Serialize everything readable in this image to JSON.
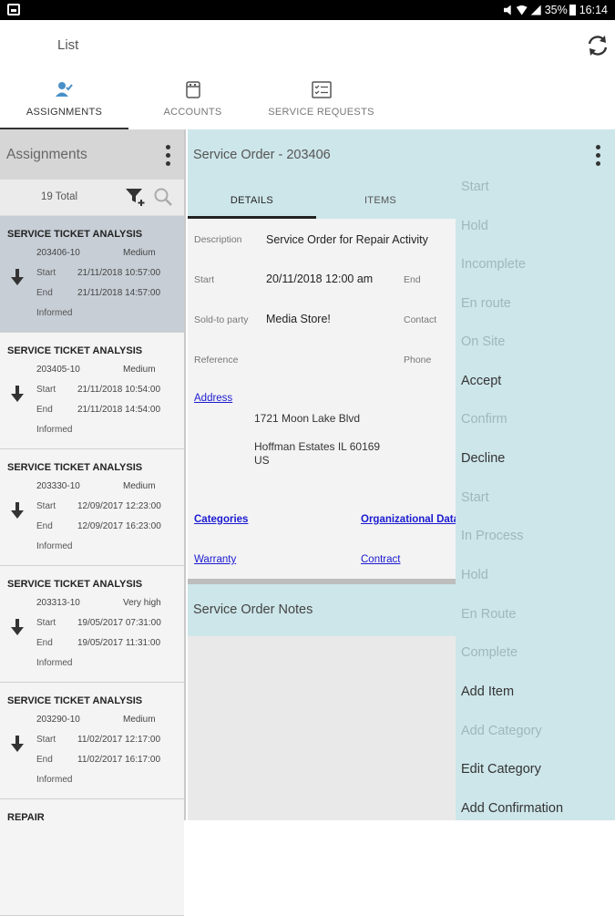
{
  "status_bar": {
    "battery": "35%",
    "time": "16:14"
  },
  "app_bar": {
    "title": "List",
    "refresh_icon": "refresh-icon"
  },
  "main_tabs": [
    {
      "label": "ASSIGNMENTS",
      "icon": "person-check-icon",
      "active": true
    },
    {
      "label": "ACCOUNTS",
      "icon": "account-book-icon",
      "active": false
    },
    {
      "label": "SERVICE REQUESTS",
      "icon": "checklist-icon",
      "active": false
    }
  ],
  "assignments": {
    "header": "Assignments",
    "total": "19 Total",
    "cards": [
      {
        "title": "SERVICE TICKET ANALYSIS",
        "id": "203406-10",
        "priority": "Medium",
        "start_label": "Start",
        "start": "21/11/2018 10:57:00",
        "end_label": "End",
        "end": "21/11/2018 14:57:00",
        "status": "Informed",
        "selected": true
      },
      {
        "title": "SERVICE TICKET ANALYSIS",
        "id": "203405-10",
        "priority": "Medium",
        "start_label": "Start",
        "start": "21/11/2018 10:54:00",
        "end_label": "End",
        "end": "21/11/2018 14:54:00",
        "status": "Informed",
        "selected": false
      },
      {
        "title": "SERVICE TICKET ANALYSIS",
        "id": "203330-10",
        "priority": "Medium",
        "start_label": "Start",
        "start": "12/09/2017 12:23:00",
        "end_label": "End",
        "end": "12/09/2017 16:23:00",
        "status": "Informed",
        "selected": false
      },
      {
        "title": "SERVICE TICKET ANALYSIS",
        "id": "203313-10",
        "priority": "Very high",
        "start_label": "Start",
        "start": "19/05/2017 07:31:00",
        "end_label": "End",
        "end": "19/05/2017 11:31:00",
        "status": "Informed",
        "selected": false
      },
      {
        "title": "SERVICE TICKET ANALYSIS",
        "id": "203290-10",
        "priority": "Medium",
        "start_label": "Start",
        "start": "11/02/2017 12:17:00",
        "end_label": "End",
        "end": "11/02/2017 16:17:00",
        "status": "Informed",
        "selected": false
      },
      {
        "title": "REPAIR",
        "id": "",
        "priority": "",
        "start_label": "",
        "start": "",
        "end_label": "",
        "end": "",
        "status": "",
        "selected": false
      }
    ]
  },
  "service_order": {
    "header": "Service Order - 203406",
    "tabs": [
      {
        "label": "DETAILS",
        "active": true
      },
      {
        "label": "ITEMS",
        "active": false
      }
    ],
    "details": {
      "description_label": "Description",
      "description": "Service Order for Repair Activity",
      "start_label": "Start",
      "start": "20/11/2018 12:00 am",
      "end_label": "End",
      "sold_to_label": "Sold-to party",
      "sold_to": "Media Store!",
      "contact_label": "Contact",
      "reference_label": "Reference",
      "phone_label": "Phone",
      "address_link": "Address",
      "address_line1": "1721 Moon Lake Blvd",
      "address_line2": "Hoffman Estates IL 60169",
      "address_line3": "US",
      "categories_link": "Categories",
      "org_data_link": "Organizational Data",
      "warranty_link": "Warranty",
      "contract_link": "Contract"
    },
    "notes_header": "Service Order Notes"
  },
  "actions": [
    {
      "label": "Start",
      "enabled": false
    },
    {
      "label": "Hold",
      "enabled": false
    },
    {
      "label": "Incomplete",
      "enabled": false
    },
    {
      "label": "En route",
      "enabled": false
    },
    {
      "label": "On Site",
      "enabled": false
    },
    {
      "label": "Accept",
      "enabled": true
    },
    {
      "label": "Confirm",
      "enabled": false
    },
    {
      "label": "Decline",
      "enabled": true
    },
    {
      "label": "Start",
      "enabled": false
    },
    {
      "label": "In Process",
      "enabled": false
    },
    {
      "label": "Hold",
      "enabled": false
    },
    {
      "label": "En Route",
      "enabled": false
    },
    {
      "label": "Complete",
      "enabled": false
    },
    {
      "label": "Add Item",
      "enabled": true
    },
    {
      "label": "Add Category",
      "enabled": false
    },
    {
      "label": "Edit Category",
      "enabled": true
    },
    {
      "label": "Add Confirmation",
      "enabled": true
    }
  ],
  "colors": {
    "panel_teal": "#cde6ea",
    "selected_card": "#c7ced6",
    "link_blue": "#1a1ad0",
    "disabled_action": "#a0b7bb"
  }
}
